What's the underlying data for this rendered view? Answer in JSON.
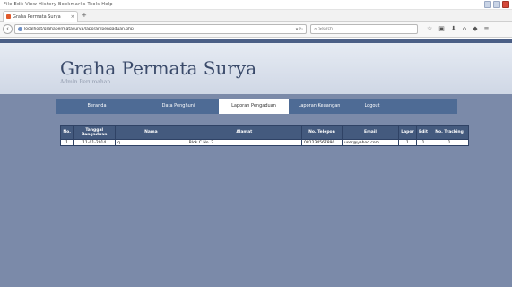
{
  "browser": {
    "menu_text": "File  Edit  View  History  Bookmarks  Tools  Help",
    "tab_label": "Graha Permata Surya",
    "url": "localhost/grahapermatasurya/laporan/pengaduan.php",
    "search_placeholder": "Search"
  },
  "site": {
    "title": "Graha Permata Surya",
    "subtitle": "Admin Perumahan"
  },
  "nav": {
    "items": [
      {
        "label": "Beranda"
      },
      {
        "label": "Data Penghuni"
      },
      {
        "label": "Laporan Pengaduan"
      },
      {
        "label": "Laporan Keuangan"
      },
      {
        "label": "Logout"
      }
    ]
  },
  "table": {
    "headers": [
      "No.",
      "Tanggal Pengaduan",
      "Nama",
      "Alamat",
      "No. Telepon",
      "Email",
      "Lapor",
      "Edit",
      "No. Tracking"
    ],
    "rows": [
      [
        "1",
        "11-01-2014",
        "q",
        "Blok C No. 2",
        "081234567890",
        "user@yahoo.com",
        "1",
        "1",
        "1"
      ]
    ]
  }
}
